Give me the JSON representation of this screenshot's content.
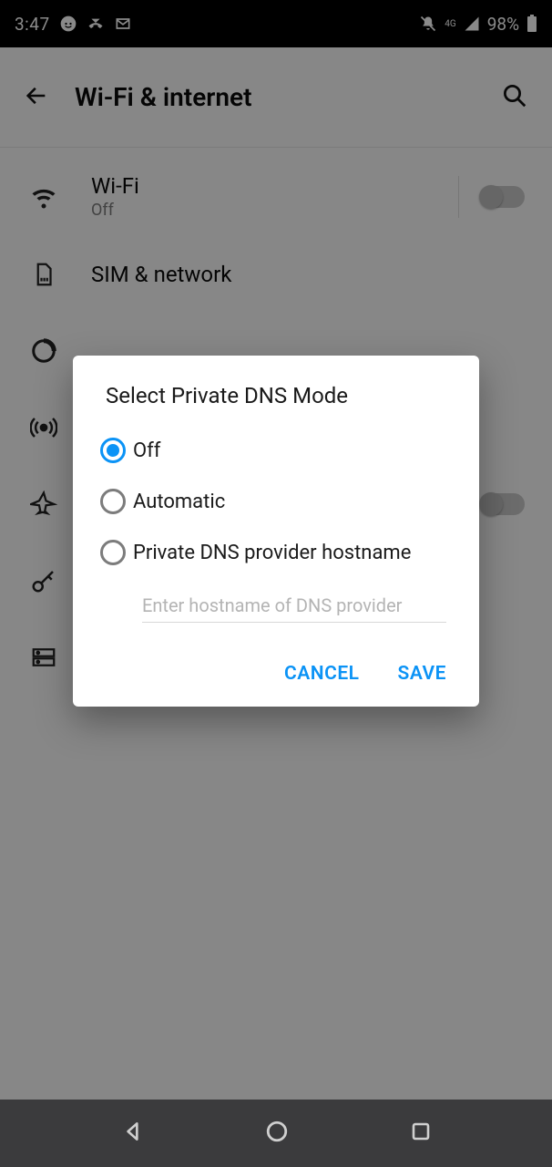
{
  "status": {
    "time": "3:47",
    "battery": "98%",
    "network_type": "4G"
  },
  "header": {
    "title": "Wi-Fi & internet"
  },
  "rows": {
    "wifi": {
      "label": "Wi-Fi",
      "sub": "Off"
    },
    "sim": {
      "label": "SIM & network"
    }
  },
  "dialog": {
    "title": "Select Private DNS Mode",
    "options": {
      "off": "Off",
      "auto": "Automatic",
      "provider": "Private DNS provider hostname"
    },
    "hostname_placeholder": "Enter hostname of DNS provider",
    "cancel": "CANCEL",
    "save": "SAVE"
  }
}
